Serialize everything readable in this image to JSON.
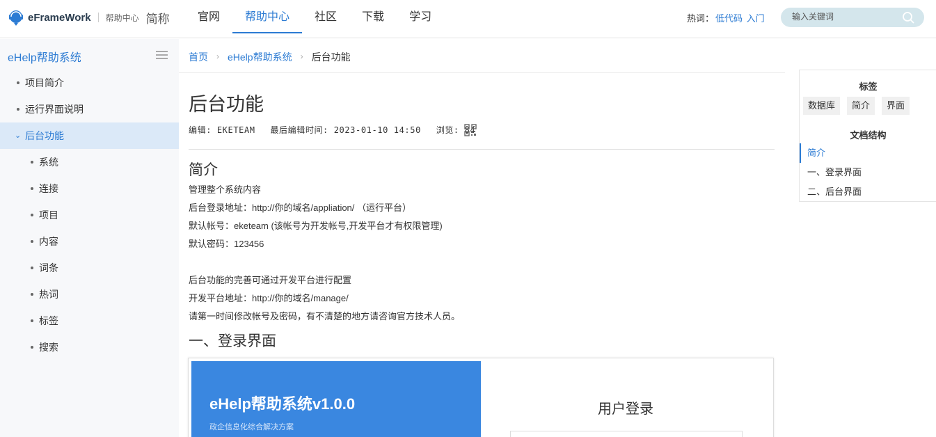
{
  "header": {
    "brand": "eFrameWork",
    "brand_sub": "帮助中心",
    "brand_short": "简称",
    "nav": [
      "官网",
      "帮助中心",
      "社区",
      "下载",
      "学习"
    ],
    "nav_active": 1,
    "hot_label": "热词：",
    "hot_words": [
      "低代码",
      "入门"
    ],
    "search_placeholder": "输入关键词"
  },
  "sidebar": {
    "title": "eHelp帮助系统",
    "items": [
      {
        "label": "项目简介",
        "level": 1
      },
      {
        "label": "运行界面说明",
        "level": 1
      },
      {
        "label": "后台功能",
        "level": 1,
        "expanded": true,
        "active": true
      },
      {
        "label": "系统",
        "level": 2
      },
      {
        "label": "连接",
        "level": 2
      },
      {
        "label": "项目",
        "level": 2
      },
      {
        "label": "内容",
        "level": 2
      },
      {
        "label": "词条",
        "level": 2
      },
      {
        "label": "热词",
        "level": 2
      },
      {
        "label": "标签",
        "level": 2
      },
      {
        "label": "搜索",
        "level": 2
      }
    ]
  },
  "breadcrumb": [
    "首页",
    "eHelp帮助系统",
    "后台功能"
  ],
  "article": {
    "title": "后台功能",
    "editor": "编辑: EKETEAM",
    "updated": "最后编辑时间: 2023-01-10 14:50",
    "views": "浏览: 84",
    "section1_title": "简介",
    "lines1": [
      "管理整个系统内容",
      "后台登录地址：http://你的域名/appliation/ （运行平台）",
      "默认帐号：eketeam (该帐号为开发帐号,开发平台才有权限管理)",
      "默认密码：123456"
    ],
    "lines2": [
      "后台功能的完善可通过开发平台进行配置",
      "开发平台地址：http://你的域名/manage/",
      "请第一时间修改帐号及密码，有不清楚的地方请咨询官方技术人员。"
    ],
    "section2_title": "一、登录界面",
    "screenshot": {
      "title": "eHelp帮助系统v1.0.0",
      "subtitle": "政企信息化综合解决方案",
      "login_title": "用户登录"
    }
  },
  "right_panel": {
    "tags_title": "标签",
    "tags": [
      "数据库",
      "简介",
      "界面"
    ],
    "toc_title": "文档结构",
    "toc": [
      "简介",
      "一、登录界面",
      "二、后台界面"
    ],
    "toc_active": 0
  },
  "colors": {
    "accent": "#2c7bd3",
    "sidebar_bg": "#f7f8fa",
    "active_bg": "#dbe9f8",
    "banner_blue": "#3a87e0"
  }
}
